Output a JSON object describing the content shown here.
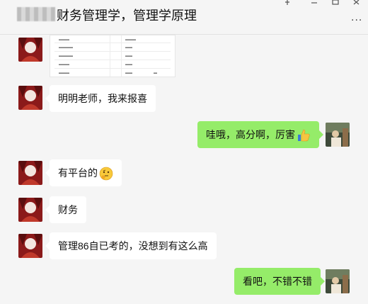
{
  "window": {
    "title": "财务管理学，管理学原理",
    "controls": [
      "pin-icon",
      "minimize-icon",
      "maximize-icon",
      "close-icon"
    ],
    "more_icon": "..."
  },
  "messages": [
    {
      "side": "left",
      "type": "image",
      "text": ""
    },
    {
      "side": "left",
      "type": "text",
      "text": "明明老师，我来报喜"
    },
    {
      "side": "right",
      "type": "text",
      "text": "哇哦，高分啊，厉害",
      "emoji": "thumbs-up"
    },
    {
      "side": "left",
      "type": "text",
      "text": "有平台的",
      "emoji": "thinking-face"
    },
    {
      "side": "left",
      "type": "text",
      "text": "财务"
    },
    {
      "side": "left",
      "type": "text",
      "text": "管理86自已考的，没想到有这么高"
    },
    {
      "side": "right",
      "type": "text",
      "text": "看吧，不错不错"
    }
  ],
  "colors": {
    "bubble_self": "#95ec69",
    "bubble_other": "#ffffff",
    "background": "#f5f5f5"
  }
}
